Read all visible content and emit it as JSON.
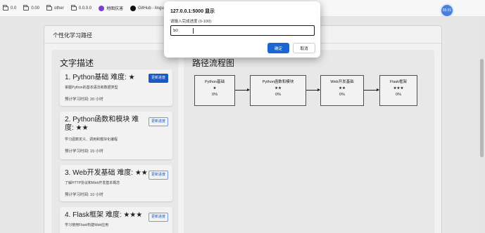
{
  "bookmarks": [
    {
      "label": "0.0",
      "icon": "folder-icon"
    },
    {
      "label": "0.00",
      "icon": "folder-icon"
    },
    {
      "label": "other",
      "icon": "folder-icon"
    },
    {
      "label": "0.0.0.0",
      "icon": "folder-icon"
    },
    {
      "label": "地图抗害",
      "icon": "app-icon"
    },
    {
      "label": "GitHub - linguish/",
      "icon": "github-icon"
    }
  ],
  "clock_text": "03:31",
  "page_title": "个性化学习路径",
  "text_section_title": "文字描述",
  "flow_section_title": "路径流程图",
  "courses": [
    {
      "name": "1. Python基础 难度: ★",
      "desc": "掌握Python的基本语法和数据类型",
      "time": "预计学习时间: 20 小时",
      "button": "更新进度",
      "primary": true
    },
    {
      "name": "2. Python函数和模块 难度: ★★",
      "desc": "学习函数定义、调用和模块化编程",
      "time": "预计学习时间: 15 小时",
      "button": "更新进度",
      "primary": false
    },
    {
      "name": "3. Web开发基础 难度: ★★",
      "desc": "了解HTTP协议和Web开发基本概念",
      "time": "预计学习时间: 10 小时",
      "button": "更新进度",
      "primary": false
    },
    {
      "name": "4. Flask框架 难度: ★★★",
      "desc": "学习使用Flask构建Web应用",
      "time": "",
      "button": "更新进度",
      "primary": false
    }
  ],
  "flow_nodes": [
    {
      "name": "Python基础",
      "stars": "★",
      "progress": "0%"
    },
    {
      "name": "Python函数和模块",
      "stars": "★★",
      "progress": "0%"
    },
    {
      "name": "Web开发基础",
      "stars": "★★",
      "progress": "0%"
    },
    {
      "name": "Flask框架",
      "stars": "★★★",
      "progress": "0%"
    }
  ],
  "dialog": {
    "origin": "127.0.0.1:5000 显示",
    "message": "请输入完成进度 (0-100):",
    "input_value": "50",
    "ok_label": "确定",
    "cancel_label": "取消"
  },
  "colors": {
    "accent": "#1a67d2",
    "overlay": "rgba(0,0,0,0.05)"
  }
}
